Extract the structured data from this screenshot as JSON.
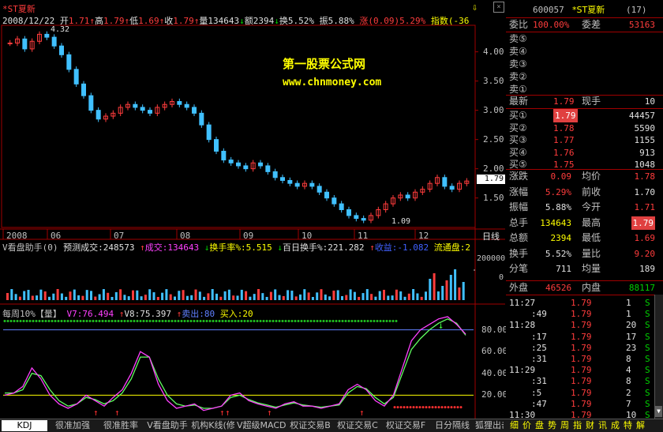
{
  "title_bar": {
    "name": "*ST夏新"
  },
  "quote_line": {
    "date": "2008/12/22",
    "open_label": "开",
    "open": "1.71",
    "high_label": "高",
    "high": "1.79",
    "low_label": "低",
    "low": "1.69",
    "close_label": "收",
    "close": "1.79",
    "volume_label": "量",
    "volume": "134643",
    "amount_label": "额",
    "amount": "2394",
    "turnover_label": "换",
    "turnover": "5.52%",
    "amplitude_label": "振",
    "amplitude": "5.88%",
    "change_label": "涨",
    "change": "(0.09)5.29%",
    "index_label": "指数",
    "index": "(-36"
  },
  "watermark": {
    "line1": "第一股票公式网",
    "line2": "www.chnmoney.com"
  },
  "price_panel": {
    "price_ticks": [
      "4.00",
      "3.50",
      "3.00",
      "2.50",
      "2.00",
      "1.50"
    ],
    "current_price": "1.79",
    "high_annotation": "4.32",
    "low_annotation": "1.09",
    "months": [
      "2008",
      "06",
      "07",
      "08",
      "09",
      "10",
      "11",
      "12"
    ],
    "period_label": "日线"
  },
  "volume_panel": {
    "header": [
      {
        "text": "V看盘助手(0)",
        "color": "#c0c0c0"
      },
      {
        "text": "预测成交:248573",
        "color": "#e0e0e0"
      },
      {
        "text": "↑",
        "color": "#ff3c3c"
      },
      {
        "text": "成交:134643",
        "color": "#ff40ff"
      },
      {
        "text": "↓",
        "color": "#00d000"
      },
      {
        "text": "换手率%:5.515",
        "color": "#ffff00"
      },
      {
        "text": "↓",
        "color": "#00d000"
      },
      {
        "text": "百日换手%:221.282",
        "color": "#e0e0e0"
      },
      {
        "text": "↑",
        "color": "#ff3c3c"
      },
      {
        "text": "收益:-1.082",
        "color": "#4060ff"
      },
      {
        "text": "流通盘:2",
        "color": "#ffff00"
      }
    ],
    "ticks": [
      "200000",
      "0"
    ]
  },
  "indicator_panel": {
    "header": [
      {
        "text": "每周10%【量】",
        "color": "#c0c0c0"
      },
      {
        "text": "V7:76.494",
        "color": "#ff40ff"
      },
      {
        "text": "↑",
        "color": "#ff3c3c"
      },
      {
        "text": "V8:75.397",
        "color": "#e0e0e0"
      },
      {
        "text": "↑",
        "color": "#ff3c3c"
      },
      {
        "text": "卖出:80",
        "color": "#6080ff"
      },
      {
        "text": "买入:20",
        "color": "#ffff00"
      }
    ],
    "ticks": [
      "80.00",
      "60.00",
      "40.00",
      "20.00"
    ]
  },
  "right_panel": {
    "code": "600057",
    "name": "*ST夏新",
    "count": "(17)",
    "commission_ratio_label": "委比",
    "commission_ratio": "100.00%",
    "commission_diff_label": "委差",
    "commission_diff": "53163",
    "sell": [
      {
        "label": "卖⑤",
        "price": "",
        "vol": ""
      },
      {
        "label": "卖④",
        "price": "",
        "vol": ""
      },
      {
        "label": "卖③",
        "price": "",
        "vol": ""
      },
      {
        "label": "卖②",
        "price": "",
        "vol": ""
      },
      {
        "label": "卖①",
        "price": "",
        "vol": ""
      }
    ],
    "latest_label": "最新",
    "latest": "1.79",
    "current_hand_label": "现手",
    "current_hand": "10",
    "buy": [
      {
        "label": "买①",
        "price": "1.79",
        "vol": "44457"
      },
      {
        "label": "买②",
        "price": "1.78",
        "vol": "5590"
      },
      {
        "label": "买③",
        "price": "1.77",
        "vol": "1155"
      },
      {
        "label": "买④",
        "price": "1.76",
        "vol": "913"
      },
      {
        "label": "买⑤",
        "price": "1.75",
        "vol": "1048"
      }
    ],
    "stats": [
      {
        "l1": "涨跌",
        "v1": "0.09",
        "c1": "red",
        "l2": "均价",
        "v2": "1.78",
        "c2": "red"
      },
      {
        "l1": "涨幅",
        "v1": "5.29%",
        "c1": "red",
        "l2": "前收",
        "v2": "1.70",
        "c2": "wht"
      },
      {
        "l1": "振幅",
        "v1": "5.88%",
        "c1": "wht",
        "l2": "今开",
        "v2": "1.71",
        "c2": "red"
      },
      {
        "l1": "总手",
        "v1": "134643",
        "c1": "yel",
        "l2": "最高",
        "v2": "1.79",
        "c2": "hl"
      },
      {
        "l1": "总额",
        "v1": "2394",
        "c1": "yel",
        "l2": "最低",
        "v2": "1.69",
        "c2": "red"
      },
      {
        "l1": "换手",
        "v1": "5.52%",
        "c1": "wht",
        "l2": "量比",
        "v2": "9.20",
        "c2": "red"
      },
      {
        "l1": "分笔",
        "v1": "711",
        "c1": "wht",
        "l2": "均量",
        "v2": "189",
        "c2": "wht"
      }
    ],
    "outer_label": "外盘",
    "outer": "46526",
    "inner_label": "内盘",
    "inner": "88117",
    "ticks": [
      {
        "time": "11:27",
        "price": "1.79",
        "vol": "1",
        "flag": "S"
      },
      {
        "time": ":49",
        "price": "1.79",
        "vol": "1",
        "flag": "S"
      },
      {
        "time": "11:28",
        "price": "1.79",
        "vol": "20",
        "flag": "S"
      },
      {
        "time": ":17",
        "price": "1.79",
        "vol": "17",
        "flag": "S"
      },
      {
        "time": ":25",
        "price": "1.79",
        "vol": "23",
        "flag": "S"
      },
      {
        "time": ":31",
        "price": "1.79",
        "vol": "8",
        "flag": "S"
      },
      {
        "time": "11:29",
        "price": "1.79",
        "vol": "4",
        "flag": "S"
      },
      {
        "time": ":31",
        "price": "1.79",
        "vol": "8",
        "flag": "S"
      },
      {
        "time": ":5",
        "price": "1.79",
        "vol": "2",
        "flag": "S"
      },
      {
        "time": ":47",
        "price": "1.79",
        "vol": "7",
        "flag": "S"
      },
      {
        "time": "11:30",
        "price": "1.79",
        "vol": "10",
        "flag": "S"
      }
    ]
  },
  "bottom_tabs": [
    "KDJ",
    "很准加强",
    "很准胜率",
    "V看盘助手",
    "机构K线(修",
    "V超级MACD",
    "权证交易B",
    "权证交易C",
    "权证交易F",
    "日分隔线",
    "狐狸出击"
  ],
  "right_tabs": [
    "细",
    "价",
    "盘",
    "势",
    "周",
    "指",
    "财",
    "讯",
    "成",
    "特",
    "解"
  ],
  "colors": {
    "up": "#ff3c3c",
    "down_candle": "#40c0ff",
    "v7_line": "#ff40ff",
    "v8_line": "#60ff60",
    "sell_line": "#6080ff",
    "buy_line": "#ffff00",
    "watermark": "#ffff00"
  },
  "chart_data": {
    "type": "candlestick",
    "series_price": [
      4.15,
      4.22,
      4.05,
      4.18,
      4.3,
      4.25,
      4.1,
      3.95,
      3.7,
      3.45,
      3.25,
      3.0,
      2.85,
      2.9,
      2.95,
      3.05,
      3.1,
      3.05,
      3.0,
      2.95,
      3.05,
      3.1,
      3.15,
      3.1,
      3.05,
      2.95,
      2.75,
      2.5,
      2.3,
      2.15,
      2.1,
      2.05,
      2.0,
      2.1,
      2.05,
      1.95,
      1.85,
      1.8,
      1.75,
      1.7,
      1.75,
      1.7,
      1.6,
      1.5,
      1.4,
      1.3,
      1.2,
      1.15,
      1.12,
      1.2,
      1.3,
      1.4,
      1.5,
      1.55,
      1.5,
      1.6,
      1.65,
      1.75,
      1.85,
      1.7,
      1.65,
      1.75,
      1.79
    ],
    "price_range": [
      1.05,
      4.4
    ],
    "series_v7": [
      20,
      22,
      28,
      45,
      35,
      20,
      12,
      8,
      12,
      20,
      15,
      10,
      18,
      25,
      40,
      60,
      55,
      30,
      15,
      8,
      10,
      12,
      6,
      8,
      10,
      20,
      22,
      15,
      12,
      10,
      8,
      12,
      14,
      10,
      10,
      8,
      10,
      12,
      25,
      30,
      25,
      15,
      10,
      20,
      45,
      70,
      80,
      85,
      90,
      92,
      85,
      76
    ],
    "series_v8": [
      22,
      22,
      25,
      40,
      38,
      25,
      15,
      10,
      12,
      18,
      16,
      12,
      15,
      22,
      35,
      55,
      55,
      35,
      20,
      12,
      10,
      11,
      8,
      8,
      10,
      18,
      20,
      16,
      13,
      11,
      9,
      11,
      13,
      11,
      10,
      9,
      10,
      11,
      22,
      28,
      26,
      18,
      12,
      18,
      40,
      62,
      72,
      80,
      86,
      90,
      86,
      75
    ],
    "indicator_range": [
      0,
      100
    ],
    "sell_level": 80,
    "buy_level": 20
  }
}
